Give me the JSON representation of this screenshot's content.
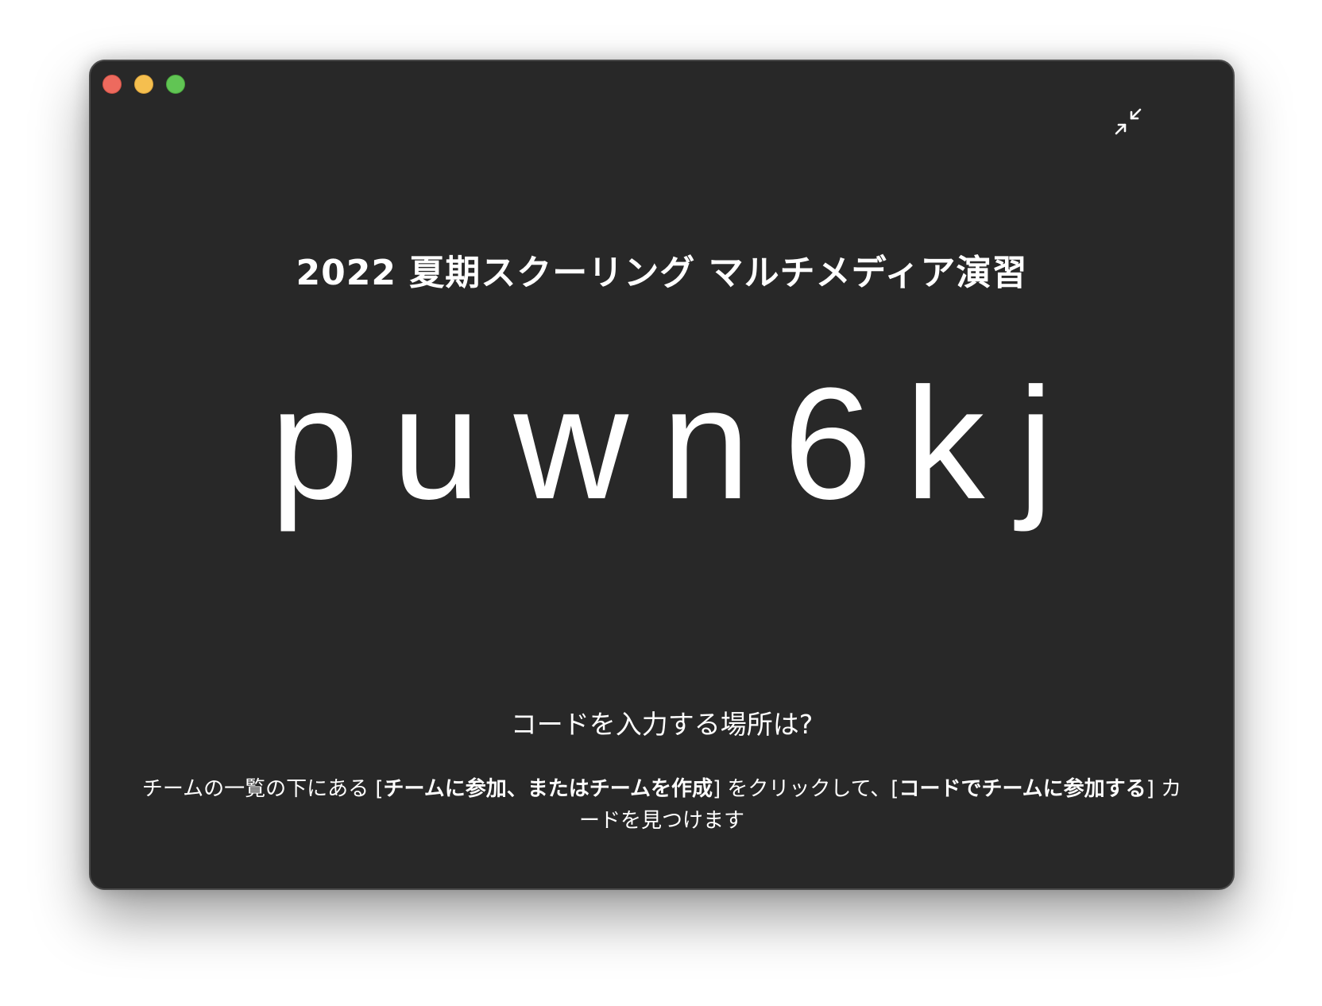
{
  "window": {
    "controls": {
      "close_color": "#ed6a5e",
      "minimize_color": "#f5bf4f",
      "zoom_color": "#61c554"
    },
    "exit_fullscreen_icon": "arrows-pointing-in-icon"
  },
  "card": {
    "title": "2022 夏期スクーリング マルチメディア演習",
    "join_code": "puwn6kj",
    "question": "コードを入力する場所は?",
    "instructions": {
      "part1": "チームの一覧の下にある [",
      "bold1": "チームに参加、またはチームを作成",
      "part2": "] をクリックして、[",
      "bold2": "コードでチームに参加する",
      "part3": "] カードを見つけます"
    }
  }
}
